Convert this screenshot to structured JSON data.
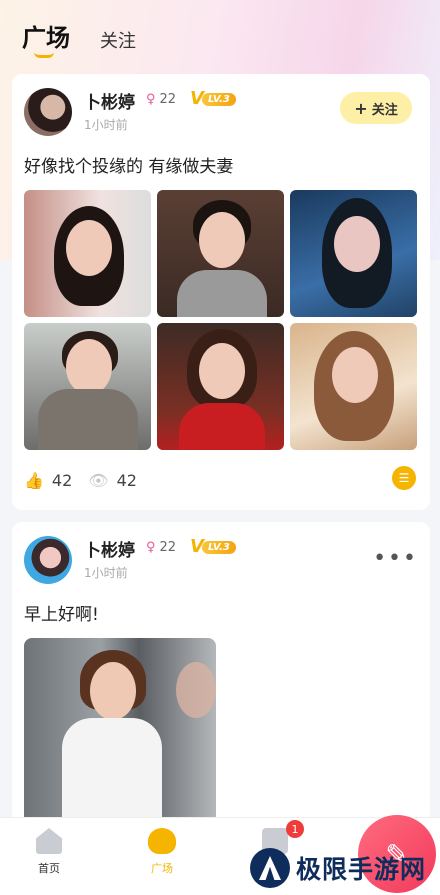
{
  "header": {
    "tabs": [
      {
        "label": "广场",
        "active": true
      },
      {
        "label": "关注",
        "active": false
      }
    ]
  },
  "posts": [
    {
      "username": "卜彬婷",
      "gender_symbol": "♀",
      "age": "22",
      "vip_v": "V",
      "vip_level": "LV.3",
      "time": "1小时前",
      "follow_label": "关注",
      "text": "好像找个投缘的 有缘做夫妻",
      "likes": "42",
      "views": "42",
      "photo_count": 6
    },
    {
      "username": "卜彬婷",
      "gender_symbol": "♀",
      "age": "22",
      "vip_v": "V",
      "vip_level": "LV.3",
      "time": "1小时前",
      "more": "•••",
      "text": "早上好啊!"
    }
  ],
  "bottom_nav": [
    {
      "label": "首页",
      "icon": "home-icon",
      "active": false
    },
    {
      "label": "广场",
      "icon": "square-icon",
      "active": true
    },
    {
      "label": "",
      "icon": "message-icon",
      "active": false,
      "badge": "1"
    }
  ],
  "fab": {
    "icon": "pen-icon"
  },
  "watermark": {
    "text": "极限手游网"
  },
  "colors": {
    "accent": "#f4b400",
    "fab": "#f23a5c",
    "badge": "#f03b3b"
  }
}
